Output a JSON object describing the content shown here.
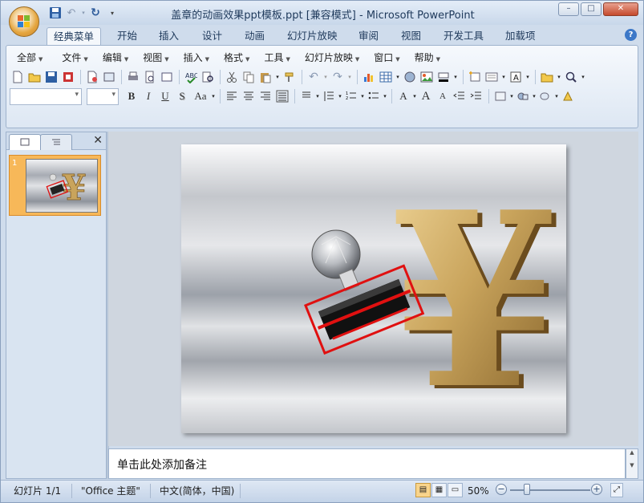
{
  "window": {
    "title": "盖章的动画效果ppt模板.ppt [兼容模式] - Microsoft PowerPoint",
    "controls": {
      "minimize": "–",
      "maximize": "□",
      "close": "✕"
    }
  },
  "qat": {
    "items": [
      "save-icon",
      "undo-icon",
      "redo-icon",
      "customize-icon"
    ]
  },
  "ribbon_tabs": [
    "经典菜单",
    "开始",
    "插入",
    "设计",
    "动画",
    "幻灯片放映",
    "审阅",
    "视图",
    "开发工具",
    "加载项"
  ],
  "active_tab": "经典菜单",
  "help_label": "?",
  "classic_menu": [
    "全部",
    "文件",
    "编辑",
    "视图",
    "插入",
    "格式",
    "工具",
    "幻灯片放映",
    "窗口",
    "帮助"
  ],
  "format_buttons": {
    "bold": "B",
    "italic": "I",
    "underline": "U",
    "shadow": "S",
    "case": "Aa"
  },
  "font_buttons": {
    "a": "A",
    "grow": "A",
    "shrink": "A"
  },
  "slides_pane": {
    "close": "✕",
    "slides": [
      {
        "number": "1"
      }
    ]
  },
  "notes": {
    "placeholder": "单击此处添加备注"
  },
  "status": {
    "slide": "幻灯片 1/1",
    "theme": "\"Office 主题\"",
    "language": "中文(简体，中国)",
    "zoom": "50%",
    "zoom_minus": "−",
    "zoom_plus": "+"
  },
  "colors": {
    "accent": "#f7b859",
    "stamp_red": "#e01010",
    "gold": "#c9a45c"
  }
}
